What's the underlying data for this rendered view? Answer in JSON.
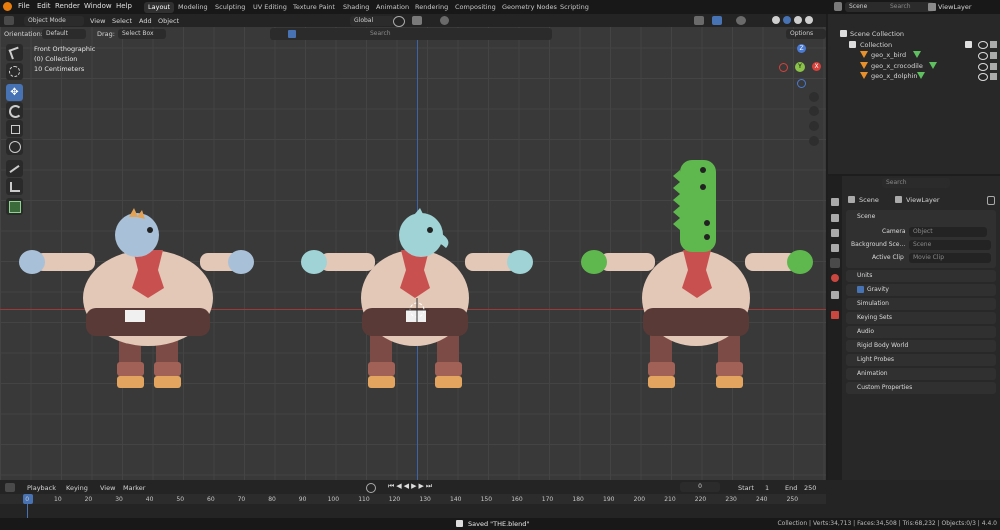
{
  "menu": [
    "File",
    "Edit",
    "Render",
    "Window",
    "Help"
  ],
  "workspaces": [
    "Layout",
    "Modeling",
    "Sculpting",
    "UV Editing",
    "Texture Paint",
    "Shading",
    "Animation",
    "Rendering",
    "Compositing",
    "Geometry Nodes",
    "Scripting"
  ],
  "scene_name": "Scene",
  "view_layer": "ViewLayer",
  "viewport": {
    "mode": "Object Mode",
    "menus": [
      "View",
      "Select",
      "Add",
      "Object"
    ],
    "transform": "Global",
    "orientation_label": "Orientation:",
    "orientation_value": "Default",
    "drag_label": "Drag:",
    "drag_value": "Select Box",
    "search_placeholder": "Search",
    "options": "Options",
    "overlay_view": "Front Orthographic",
    "overlay_collection": "(0) Collection",
    "overlay_scale": "10 Centimeters",
    "gizmo": {
      "z": "Z",
      "y": "Y",
      "x": "X"
    }
  },
  "outliner": {
    "search_placeholder": "Search",
    "scene_collection": "Scene Collection",
    "collection": "Collection",
    "items": [
      "geo_x_bird",
      "geo_x_crocodile",
      "geo_x_dolphin"
    ]
  },
  "properties": {
    "search_placeholder": "Search",
    "breadcrumb_scene": "Scene",
    "breadcrumb_layer": "ViewLayer",
    "section": "Scene",
    "camera_label": "Camera",
    "camera_value": "Object",
    "bg_label": "Background Sce...",
    "bg_value": "Scene",
    "clip_label": "Active Clip",
    "clip_value": "Movie Clip",
    "panels": [
      "Units",
      "Gravity",
      "Simulation",
      "Keying Sets",
      "Audio",
      "Rigid Body World",
      "Light Probes",
      "Animation",
      "Custom Properties"
    ]
  },
  "timeline": {
    "menus": [
      "Playback",
      "Keying",
      "View",
      "Marker"
    ],
    "current_frame": "0",
    "start_label": "Start",
    "start_value": "1",
    "end_label": "End",
    "end_value": "250",
    "ruler": [
      "0",
      "10",
      "20",
      "30",
      "40",
      "50",
      "60",
      "70",
      "80",
      "90",
      "100",
      "110",
      "120",
      "130",
      "140",
      "150",
      "160",
      "170",
      "180",
      "190",
      "200",
      "210",
      "220",
      "230",
      "240",
      "250"
    ]
  },
  "status": {
    "message": "Saved \"THE.blend\"",
    "stats": "Collection | Verts:34,713 | Faces:34,508 | Tris:68,232 | Objects:0/3 | 4.4.0"
  },
  "characters": [
    {
      "name": "bird",
      "head_color": "#a9c1d8",
      "hand_color": "#a9c1d8"
    },
    {
      "name": "dolphin",
      "head_color": "#9fd3d6",
      "hand_color": "#9fd3d6"
    },
    {
      "name": "crocodile",
      "head_color": "#5fb84e",
      "hand_color": "#5fb84e"
    }
  ]
}
